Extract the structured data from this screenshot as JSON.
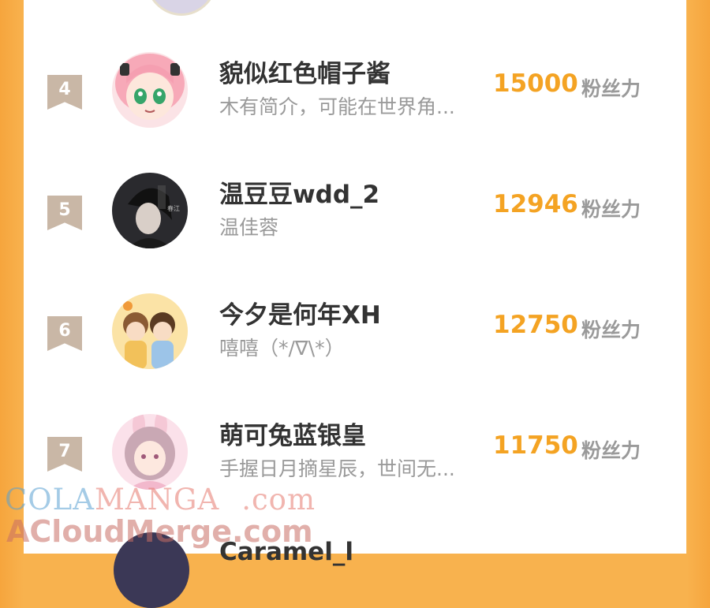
{
  "ranking": [
    {
      "rank": "4",
      "name": "貌似红色帽子酱",
      "bio": "木有简介，可能在世界角...",
      "score": "15000",
      "unit": "粉丝力",
      "avatar": "pink-hair-anime-girl-avatar"
    },
    {
      "rank": "5",
      "name": "温豆豆wdd_2",
      "bio": "温佳蓉",
      "score": "12946",
      "unit": "粉丝力",
      "avatar": "dark-haired-anime-man-avatar"
    },
    {
      "rank": "6",
      "name": "今夕是何年XH",
      "bio": "嘻嘻（*/∇\\*）",
      "score": "12750",
      "unit": "粉丝力",
      "avatar": "two-chibi-boys-avatar"
    },
    {
      "rank": "7",
      "name": "萌可兔蓝银皇",
      "bio": "手握日月摘星辰，世间无...",
      "score": "11750",
      "unit": "粉丝力",
      "avatar": "bunny-ear-girl-avatar"
    }
  ],
  "partial_next": {
    "name": "Caramel_l"
  },
  "watermark": {
    "line1_a": "COLA",
    "line1_b": "MANGA",
    "line1_c": ".com",
    "line2": "ACloudMerge.com"
  },
  "colors": {
    "accent": "#f4a323",
    "frame": "#f8b24e",
    "rank_badge": "#c9b7a6"
  }
}
